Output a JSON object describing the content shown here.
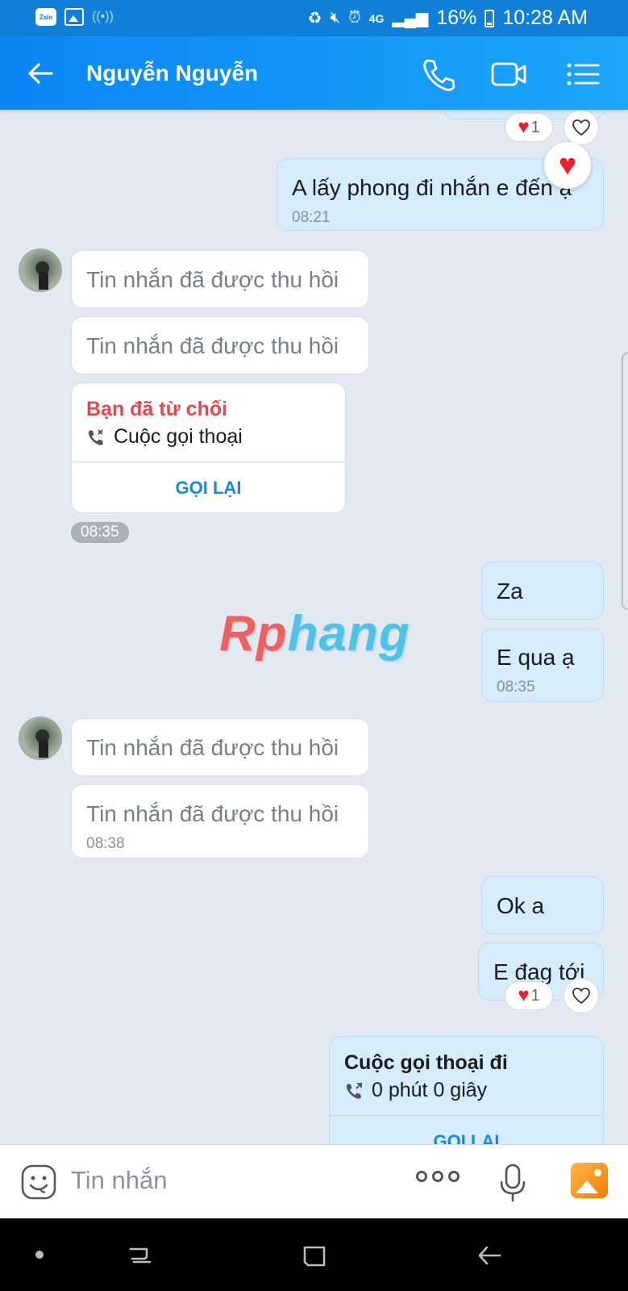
{
  "status_bar": {
    "zalo_label": "Zalo",
    "network": "4G",
    "battery": "16%",
    "time": "10:28 AM"
  },
  "header": {
    "contact_name": "Nguyễn Nguyễn"
  },
  "messages": {
    "out_1": {
      "text": "A lấy phong đi nhắn e đến ạ",
      "time": "08:21"
    },
    "in_recalled": "Tin nhắn đã được thu hồi",
    "missed_call": {
      "status": "Bạn đã từ chối",
      "type": "Cuộc gọi thoại",
      "action": "GỌI LẠI",
      "time": "08:35"
    },
    "out_za": "Za",
    "out_e_qua": {
      "text": "E qua ạ",
      "time": "08:35"
    },
    "in_recalled_time": "08:38",
    "out_ok": "Ok a",
    "out_dag_toi": "E đag tới",
    "outgoing_call": {
      "title": "Cuộc gọi thoại đi",
      "duration": "0 phút 0 giây",
      "action": "GỌI LẠI"
    },
    "reaction_count_top": "1",
    "reaction_count_bottom": "1"
  },
  "watermark": {
    "part_a": "Rp",
    "part_b": "hang"
  },
  "input": {
    "placeholder": "Tin nhắn"
  },
  "colors": {
    "header": "#0a86f5",
    "outgoing_bubble": "#d5ecfd",
    "missed_call_red": "#e8464a",
    "link_blue": "#1489e8"
  }
}
